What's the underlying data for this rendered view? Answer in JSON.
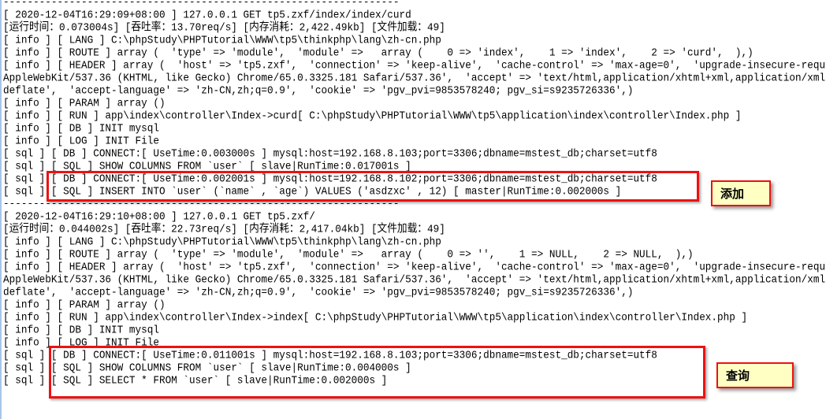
{
  "separator": "------------------------------------------------------------------",
  "blocks": [
    {
      "lines": [
        "[ 2020-12-04T16:29:09+08:00 ] 127.0.0.1 GET tp5.zxf/index/index/curd",
        "[运行时间：0.073004s] [吞吐率：13.70req/s] [内存消耗：2,422.49kb] [文件加载：49]",
        "[ info ] [ LANG ] C:\\phpStudy\\PHPTutorial\\WWW\\tp5\\thinkphp\\lang\\zh-cn.php",
        "[ info ] [ ROUTE ] array (  'type' => 'module',  'module' =>   array (    0 => 'index',    1 => 'index',    2 => 'curd',  ),)",
        "[ info ] [ HEADER ] array (  'host' => 'tp5.zxf',  'connection' => 'keep-alive',  'cache-control' => 'max-age=0',  'upgrade-insecure-requests' => '1',",
        "AppleWebKit/537.36 (KHTML, like Gecko) Chrome/65.0.3325.181 Safari/537.36',  'accept' => 'text/html,application/xhtml+xml,application/xml",
        "deflate',  'accept-language' => 'zh-CN,zh;q=0.9',  'cookie' => 'pgv_pvi=9853578240; pgv_si=s9235726336',)",
        "[ info ] [ PARAM ] array ()",
        "[ info ] [ RUN ] app\\index\\controller\\Index->curd[ C:\\phpStudy\\PHPTutorial\\WWW\\tp5\\application\\index\\controller\\Index.php ]",
        "[ info ] [ DB ] INIT mysql",
        "[ info ] [ LOG ] INIT File",
        "[ sql ] [ DB ] CONNECT:[ UseTime:0.003000s ] mysql:host=192.168.8.103;port=3306;dbname=mstest_db;charset=utf8",
        "[ sql ] [ SQL ] SHOW COLUMNS FROM `user` [ slave|RunTime:0.017001s ]",
        "[ sql ] [ DB ] CONNECT:[ UseTime:0.002001s ] mysql:host=192.168.8.102;port=3306;dbname=mstest_db;charset=utf8",
        "[ sql ] [ SQL ] INSERT INTO `user` (`name` , `age`) VALUES ('asdzxc' , 12) [ master|RunTime:0.002000s ]"
      ]
    },
    {
      "lines": [
        "[ 2020-12-04T16:29:10+08:00 ] 127.0.0.1 GET tp5.zxf/",
        "[运行时间：0.044002s] [吞吐率：22.73req/s] [内存消耗：2,417.04kb] [文件加载：49]",
        "[ info ] [ LANG ] C:\\phpStudy\\PHPTutorial\\WWW\\tp5\\thinkphp\\lang\\zh-cn.php",
        "[ info ] [ ROUTE ] array (  'type' => 'module',  'module' =>   array (    0 => '',    1 => NULL,    2 => NULL,  ),)",
        "[ info ] [ HEADER ] array (  'host' => 'tp5.zxf',  'connection' => 'keep-alive',  'cache-control' => 'max-age=0',  'upgrade-insecure-requests' => '1',",
        "AppleWebKit/537.36 (KHTML, like Gecko) Chrome/65.0.3325.181 Safari/537.36',  'accept' => 'text/html,application/xhtml+xml,application/xml",
        "deflate',  'accept-language' => 'zh-CN,zh;q=0.9',  'cookie' => 'pgv_pvi=9853578240; pgv_si=s9235726336',)",
        "[ info ] [ PARAM ] array ()",
        "[ info ] [ RUN ] app\\index\\controller\\Index->index[ C:\\phpStudy\\PHPTutorial\\WWW\\tp5\\application\\index\\controller\\Index.php ]",
        "[ info ] [ DB ] INIT mysql",
        "[ info ] [ LOG ] INIT File",
        "[ sql ] [ DB ] CONNECT:[ UseTime:0.011001s ] mysql:host=192.168.8.103;port=3306;dbname=mstest_db;charset=utf8",
        "[ sql ] [ SQL ] SHOW COLUMNS FROM `user` [ slave|RunTime:0.004000s ]",
        "[ sql ] [ SQL ] SELECT * FROM `user` [ slave|RunTime:0.002000s ]"
      ]
    }
  ],
  "annotations": {
    "insert_label": "添加",
    "select_label": "查询",
    "highlight_color": "#ee1111",
    "label_bg": "#ffffc4"
  }
}
